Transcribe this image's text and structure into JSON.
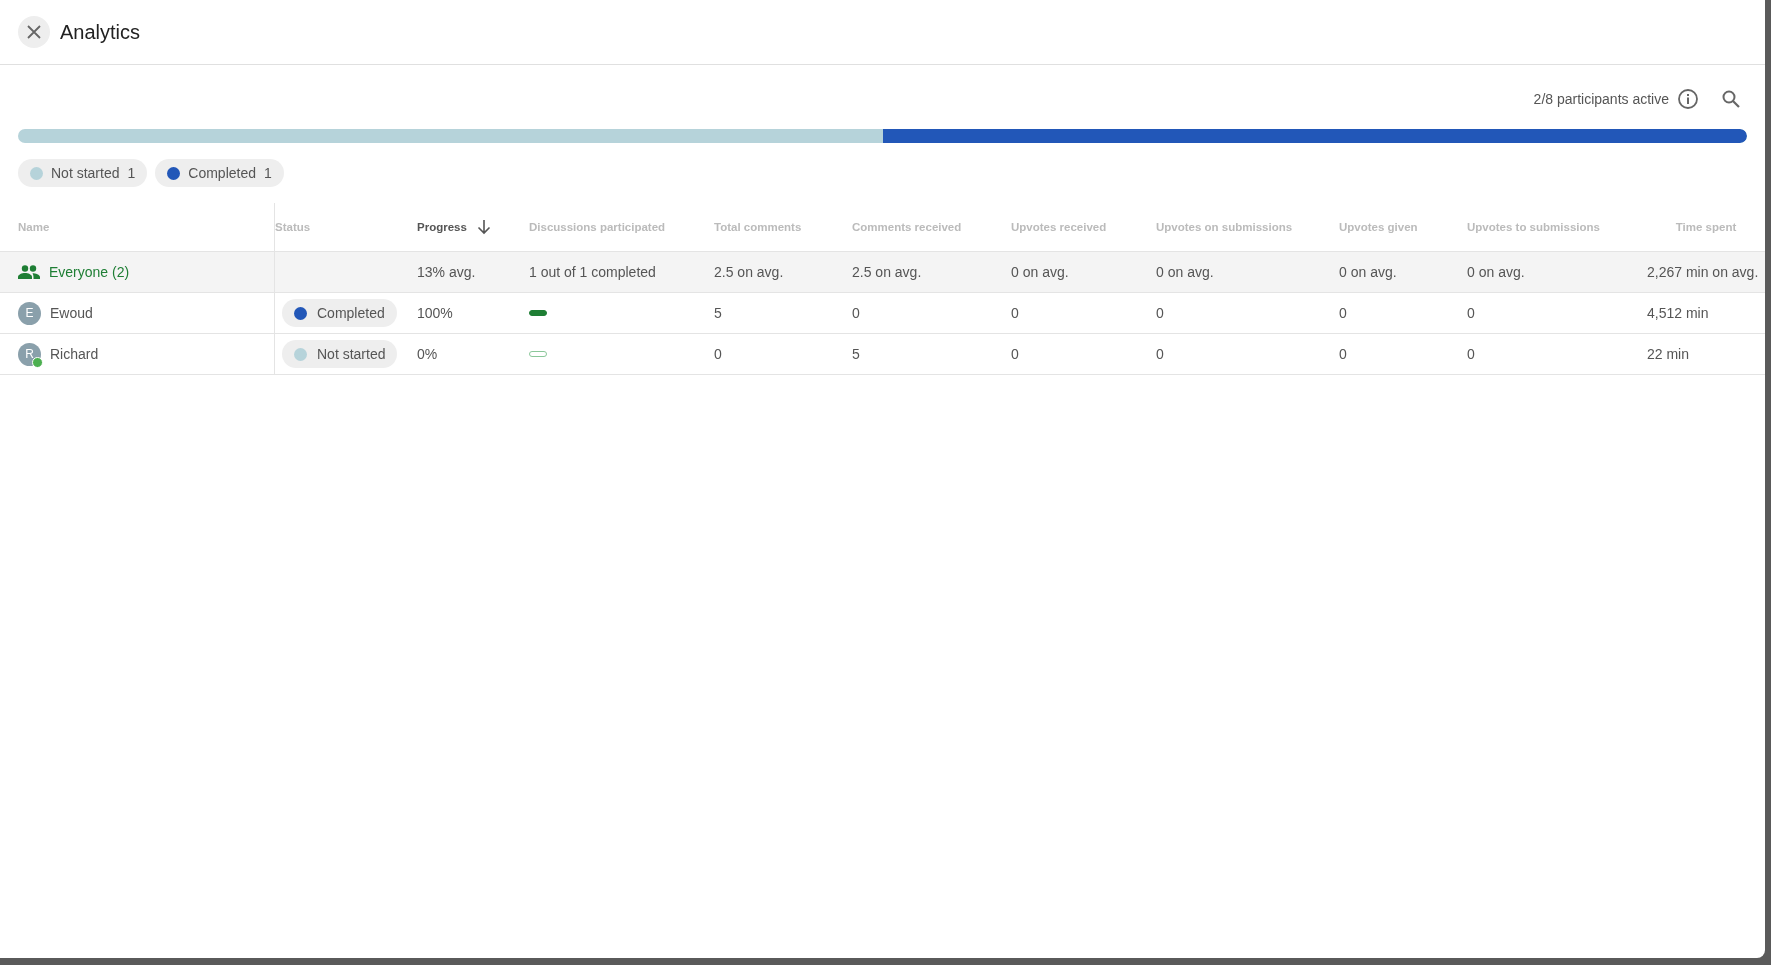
{
  "window": {
    "title": "Analytics"
  },
  "participants_active": "2/8 participants active",
  "status_bar": {
    "level": 0.5
  },
  "legend": [
    {
      "label": "Not started",
      "count": "1",
      "color": "#b6d3da"
    },
    {
      "label": "Completed",
      "count": "1",
      "color": "#2257b8"
    }
  ],
  "table": {
    "columns": [
      {
        "label": "Name",
        "sorted": false
      },
      {
        "label": "Status",
        "sorted": false
      },
      {
        "label": "Progress",
        "sorted": true
      },
      {
        "label": "Discussions participated",
        "sorted": false
      },
      {
        "label": "Total comments",
        "sorted": false
      },
      {
        "label": "Comments received",
        "sorted": false
      },
      {
        "label": "Upvotes received",
        "sorted": false
      },
      {
        "label": "Upvotes on submissions",
        "sorted": false
      },
      {
        "label": "Upvotes given",
        "sorted": false
      },
      {
        "label": "Upvotes to submissions",
        "sorted": false
      },
      {
        "label": "Time spent",
        "sorted": false
      }
    ],
    "summary": {
      "cells": [
        "Everyone (2)",
        "",
        "13% avg.",
        "1 out of 1 completed",
        "2.5 on avg.",
        "2.5 on avg.",
        "0 on avg.",
        "0 on avg.",
        "0 on avg.",
        "0 on avg.",
        "2,267 min on avg."
      ]
    },
    "rows": [
      {
        "initial": "E",
        "online": false,
        "color": "#2257b8",
        "discussion_completed": true,
        "cells": [
          "Ewoud",
          "Completed",
          "100%",
          "",
          "5",
          "0",
          "0",
          "0",
          "0",
          "0",
          "4,512 min"
        ]
      },
      {
        "initial": "R",
        "online": true,
        "color": "#b6d3da",
        "discussion_completed": false,
        "cells": [
          "Richard",
          "Not started",
          "0%",
          "",
          "0",
          "5",
          "0",
          "0",
          "0",
          "0",
          "22 min"
        ]
      }
    ]
  }
}
